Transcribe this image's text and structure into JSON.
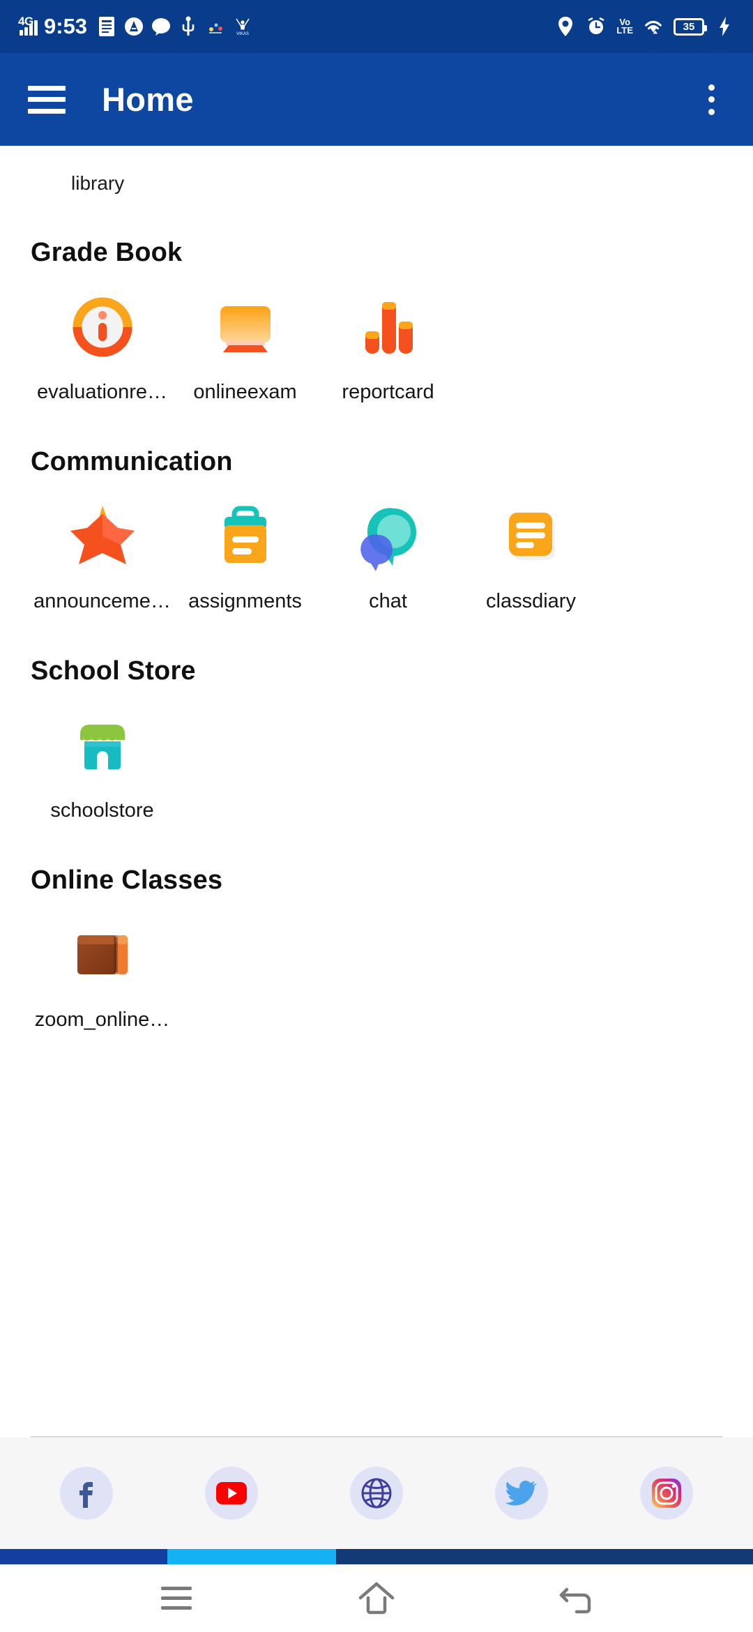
{
  "statusbar": {
    "network_type": "4G",
    "time": "9:53",
    "volte_top": "Vo",
    "volte_bottom": "LTE",
    "battery_level": "35",
    "app_badge_text": "VIKAS",
    "icons_left": [
      "signal-bars-icon",
      "document-notification-icon",
      "a-circle-icon",
      "chat-bubble-icon",
      "usb-icon",
      "app-badge-icon",
      "vikas-app-icon"
    ],
    "icons_right": [
      "location-pin-icon",
      "alarm-clock-icon",
      "volte-icon",
      "wifi-icon",
      "battery-icon",
      "charging-bolt-icon"
    ]
  },
  "appbar": {
    "title": "Home",
    "menu_icon": "hamburger-menu-icon",
    "overflow_icon": "kebab-menu-icon",
    "background": "#0D47A1"
  },
  "content": {
    "orphan_label": "library",
    "sections": [
      {
        "title": "Grade Book",
        "items": [
          {
            "label": "evaluationre…",
            "icon": "info-circle-icon",
            "color": "#F4511E"
          },
          {
            "label": "onlineexam",
            "icon": "monitor-icon",
            "color": "#FFA726"
          },
          {
            "label": "reportcard",
            "icon": "bar-chart-icon",
            "color": "#F4511E"
          }
        ]
      },
      {
        "title": "Communication",
        "items": [
          {
            "label": "announceme…",
            "icon": "star-icon",
            "color": "#F4511E"
          },
          {
            "label": "assignments",
            "icon": "clipboard-icon",
            "color": "#FBA51A"
          },
          {
            "label": "chat",
            "icon": "chat-bubbles-icon",
            "color": "#16C3B8"
          },
          {
            "label": "classdiary",
            "icon": "note-lines-icon",
            "color": "#FBA51A"
          }
        ]
      },
      {
        "title": "School Store",
        "items": [
          {
            "label": "schoolstore",
            "icon": "storefront-icon",
            "color": "#8CC63E"
          }
        ]
      },
      {
        "title": "Online Classes",
        "items": [
          {
            "label": "zoom_online…",
            "icon": "book-icon",
            "color": "#8D3B16"
          }
        ]
      }
    ]
  },
  "social": {
    "items": [
      {
        "name": "facebook",
        "icon": "facebook-icon",
        "color": "#3b5998"
      },
      {
        "name": "youtube",
        "icon": "youtube-icon",
        "color": "#FF0000"
      },
      {
        "name": "website",
        "icon": "globe-icon",
        "color": "#3F3D9E"
      },
      {
        "name": "twitter",
        "icon": "twitter-icon",
        "color": "#4BA3EB"
      },
      {
        "name": "instagram",
        "icon": "instagram-icon",
        "color": "#E1306C"
      }
    ]
  },
  "navbar": {
    "recents_icon": "recents-menu-icon",
    "home_icon": "home-icon",
    "back_icon": "back-arrow-icon"
  },
  "colors": {
    "status_bar": "#0A3C8C",
    "app_bar": "#0D47A1",
    "tricolor_left": "#143f9e",
    "tricolor_mid": "#14b2f5",
    "tricolor_right": "#133a74"
  }
}
